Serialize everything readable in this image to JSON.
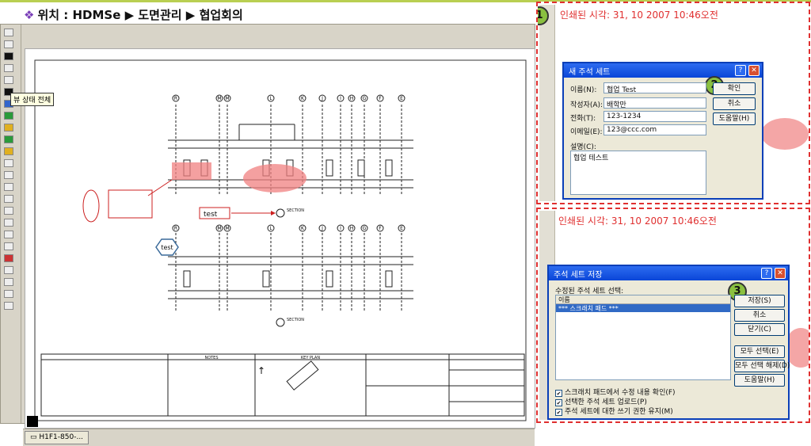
{
  "breadcrumb": {
    "text": "위치 : HDMSe ▶ 도면관리 ▶ 협업회의"
  },
  "viewer": {
    "tooltip": "뷰 상태 전체",
    "tab_label": "H1F1-850-..."
  },
  "drawing": {
    "grid_bubbles_top": [
      "R",
      "M",
      "M",
      "L",
      "K",
      "J",
      "I",
      "H",
      "G",
      "F",
      "E"
    ],
    "grid_bubbles_bottom": [
      "R",
      "M",
      "M",
      "L",
      "K",
      "J",
      "I",
      "H",
      "G",
      "F",
      "E"
    ],
    "markup_box_text": "test",
    "hexagon_text": "test",
    "section_label": "SECTION",
    "notes_title": "NOTES",
    "keyplan_title": "KEY PLAN"
  },
  "panel1": {
    "badge": "1",
    "printed_time": "인쇄된 시각: 31, 10 2007 10:46오전",
    "dialog": {
      "title": "새 주석 세트",
      "badge": "2",
      "name_label": "이름(N):",
      "name_value": "협업 Test",
      "author_label": "작성자(A):",
      "author_value": "배학만",
      "phone_label": "전화(T):",
      "phone_value": "123-1234",
      "email_label": "이메일(E):",
      "email_value": "123@ccc.com",
      "desc_label": "설명(C):",
      "desc_value": "협업 테스트",
      "ok_button": "확인",
      "cancel_button": "취소",
      "help_button": "도움말(H)"
    }
  },
  "panel2": {
    "printed_time": "인쇄된 시각: 31, 10 2007 10:46오전",
    "dialog": {
      "title": "주석 세트 저장",
      "badge": "3",
      "list_label": "수정된 주석 세트 선택:",
      "column_name": "이름",
      "list_item": "*** 스크래치 패드 ***",
      "save_button": "저장(S)",
      "cancel_button": "취소",
      "close_button": "닫기(C)",
      "select_all_button": "모두 선택(E)",
      "deselect_all_button": "모두 선택 해제(D)",
      "help_button": "도움말(H)",
      "check1": "스크래치 패드에서 수정 내용 확인(F)",
      "check2": "선택한 주석 세트 업로드(P)",
      "check3": "주석 세트에 대한 쓰기 권한 유지(M)"
    }
  },
  "colors": {
    "accent_red": "#e03030",
    "title_blue": "#0a46d8",
    "badge_green": "#8ac040",
    "markup_pink": "#f08080"
  }
}
